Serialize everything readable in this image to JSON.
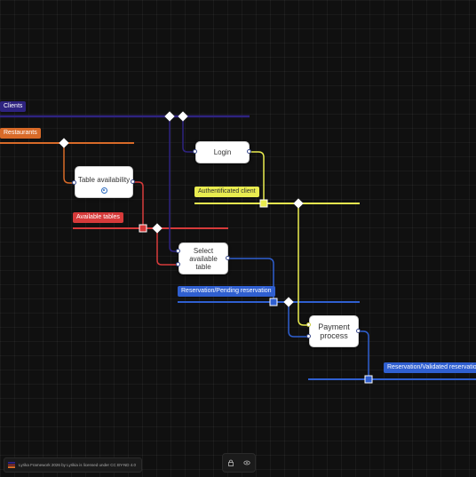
{
  "colors": {
    "clients": "#2e2380",
    "restaurants": "#d86a28",
    "available_tables": "#d63a3a",
    "authenticated_client": "#e9ec4f",
    "pending_reservation": "#2f5fd0",
    "validated_reservation": "#2f5fd0"
  },
  "lanes": {
    "clients": "Clients",
    "restaurants": "Restaurants",
    "available_tables": "Available tables",
    "authenticated_client": "Authentificated client",
    "pending_reservation": "Reservation/Pending reservation",
    "validated_reservation": "Reservation/Validated reservation"
  },
  "nodes": {
    "table_availability": "Table availability",
    "login": "Login",
    "select_table": [
      "Select",
      "available",
      "table"
    ],
    "payment": [
      "Payment",
      "process"
    ]
  },
  "footer": {
    "license": "Lyrika Framework 2026 by Lyrikia is licensed under CC BY-ND 4.0"
  },
  "controls": {
    "lock_icon": "lock-icon",
    "view_icon": "eye-icon"
  }
}
